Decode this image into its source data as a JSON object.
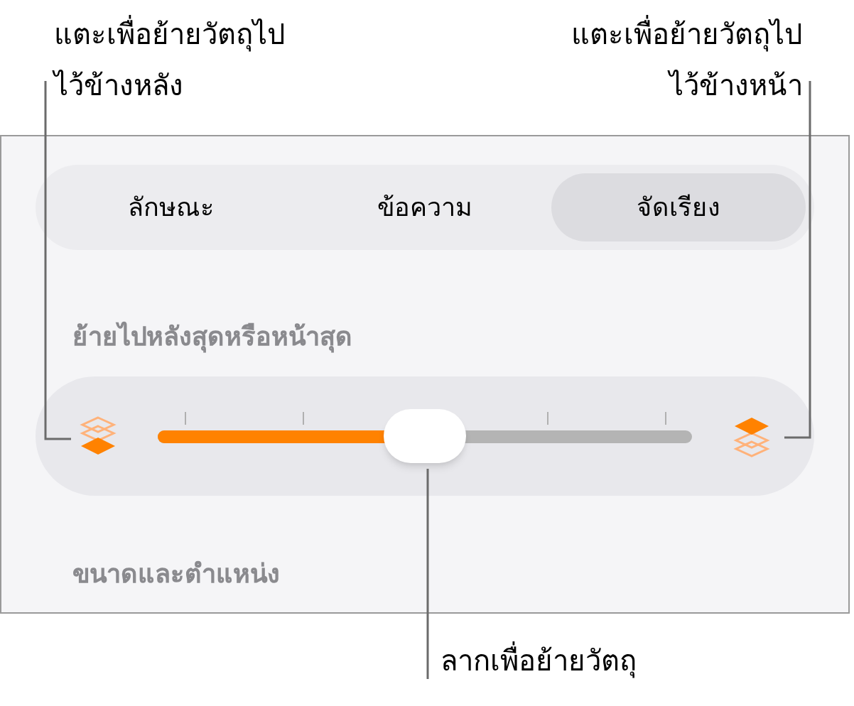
{
  "callouts": [
    {
      "text": "แตะเพื่อย้ายวัตถุไป\nไว้ข้างหลัง"
    },
    {
      "text": "แตะเพื่อย้ายวัตถุไป\nไว้ข้างหน้า"
    },
    {
      "text": "ลากเพื่อย้ายวัตถุ"
    }
  ],
  "tabs": [
    {
      "label": "ลักษณะ",
      "selected": false
    },
    {
      "label": "ข้อความ",
      "selected": false
    },
    {
      "label": "จัดเรียง",
      "selected": true
    }
  ],
  "arrange": {
    "header": "ย้ายไปหลังสุดหรือหน้าสุด",
    "level": 0.5
  },
  "size_section": {
    "header": "ขนาดและตำแหน่ง"
  }
}
